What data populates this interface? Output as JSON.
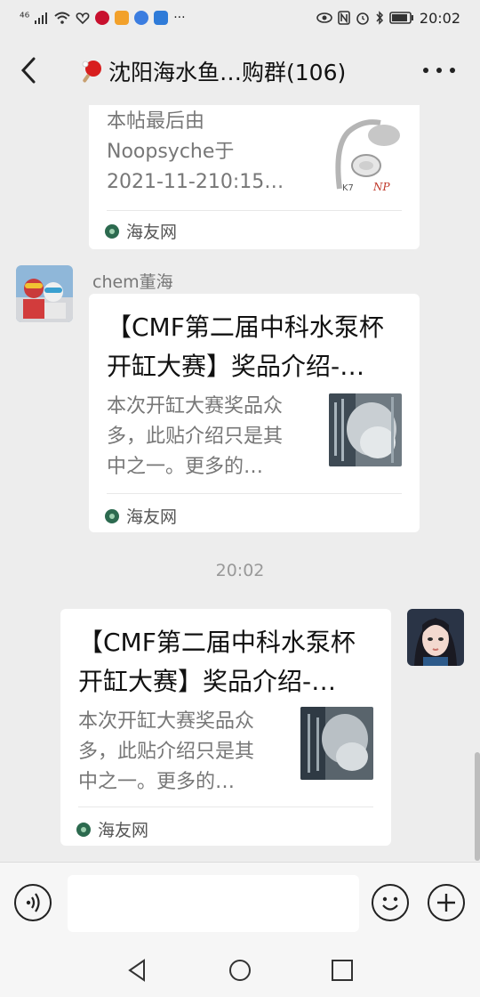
{
  "status_bar": {
    "signal_label": "⁴⁶",
    "time": "20:02"
  },
  "header": {
    "title": "沈阳海水鱼…购群(106)"
  },
  "messages": [
    {
      "id": "partial-card",
      "desc_lines": [
        "本帖最后由",
        "Noopsyche于",
        "2021-11-210:15…"
      ],
      "source": "海友网"
    },
    {
      "id": "chem-card",
      "sender": "chem董海",
      "title_lines": [
        "【CMF第二届中科水泵杯",
        "开缸大赛】奖品介绍-…"
      ],
      "desc_lines": [
        "本次开缸大赛奖品众",
        "多，此贴介绍只是其",
        "中之一。更多的…"
      ],
      "source": "海友网"
    },
    {
      "id": "self-card",
      "title_lines": [
        "【CMF第二届中科水泵杯",
        "开缸大赛】奖品介绍-…"
      ],
      "desc_lines": [
        "本次开缸大赛奖品众",
        "多，此贴介绍只是其",
        "中之一。更多的…"
      ],
      "source": "海友网"
    }
  ],
  "timestamp": "20:02",
  "thumb_text": {
    "brand": "K7",
    "logo": "NP"
  },
  "icons": {
    "back": "chevron-left-icon",
    "more": "more-dots-icon",
    "voice": "voice-icon",
    "emoji": "emoji-icon",
    "plus": "plus-icon"
  }
}
